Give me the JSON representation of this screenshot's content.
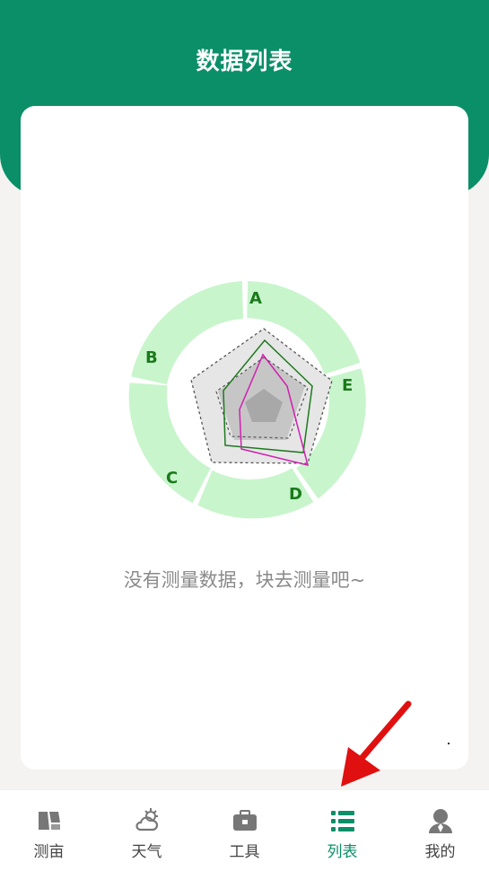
{
  "header": {
    "title": "数据列表"
  },
  "radar": {
    "labels": [
      "A",
      "B",
      "C",
      "D",
      "E"
    ]
  },
  "empty_state": {
    "message": "没有测量数据，块去测量吧~"
  },
  "tabbar": {
    "items": [
      {
        "label": "测亩",
        "icon": "map-icon"
      },
      {
        "label": "天气",
        "icon": "weather-icon"
      },
      {
        "label": "工具",
        "icon": "toolbox-icon"
      },
      {
        "label": "列表",
        "icon": "list-icon",
        "active": true
      },
      {
        "label": "我的",
        "icon": "user-icon"
      }
    ]
  },
  "colors": {
    "primary": "#0b8f68",
    "ring": "#c8f5cc",
    "radar_green": "#1e7a1e",
    "radar_magenta": "#d020b0",
    "arrow": "#e01010"
  }
}
